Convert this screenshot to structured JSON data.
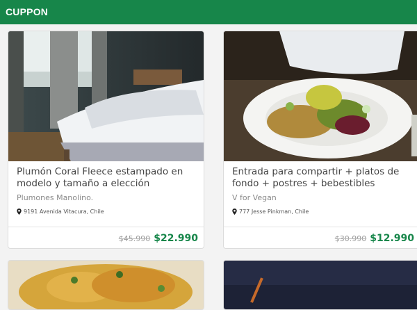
{
  "navbar": {
    "brand": "CUPPON"
  },
  "cards": [
    {
      "title": "Plumón Coral Fleece estampado en modelo y tamaño a elección",
      "vendor": "Plumones Manolino.",
      "address": "9191 Avenida Vitacura, Chile",
      "price_old": "$45.990",
      "price_new": "$22.990",
      "image": "bedroom-photo"
    },
    {
      "title": "Entrada para compartir + platos de fondo + postres + bebestibles",
      "vendor": "V for Vegan",
      "address": "777 Jesse Pinkman, Chile",
      "price_old": "$30.990",
      "price_new": "$12.990",
      "image": "vegan-plate-photo"
    },
    {
      "image": "food-photo"
    },
    {
      "image": "night-photo"
    }
  ],
  "colors": {
    "brand_green": "#17864a"
  },
  "icons": {
    "address": "map-pin-icon"
  }
}
